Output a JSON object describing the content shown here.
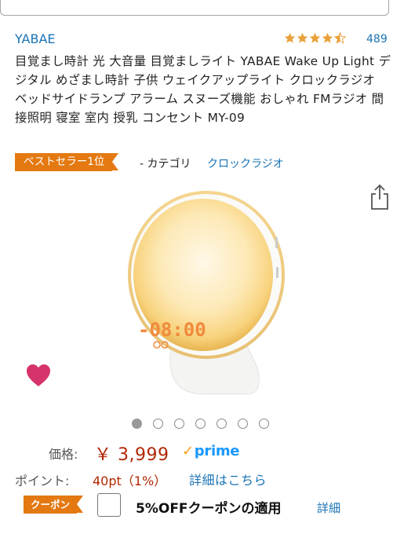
{
  "brand": "YABAE",
  "rating": {
    "stars": 4.5,
    "count": "489",
    "color": "#e9a13b"
  },
  "title": "目覚まし時計 光 大音量 目覚ましライト YABAE Wake Up Light デジタル めざまし時計 子供 ウェイクアップライト クロックラジオ ベッドサイドランプ アラーム スヌーズ機能 おしゃれ FMラジオ 間接照明 寝室 室内 授乳 コンセント MY-09",
  "bestseller": {
    "label": "ベストセラー1位",
    "prefix": "- カテゴリ",
    "category": "クロックラジオ"
  },
  "product": {
    "clock_display": "-08:00"
  },
  "carousel": {
    "count": 7,
    "active": 0
  },
  "price": {
    "label": "価格:",
    "value": "￥ 3,999",
    "prime_check": "✓",
    "prime_label": "prime"
  },
  "points": {
    "label": "ポイント:",
    "value": "40pt（1%）",
    "link": "詳細はこちら"
  },
  "coupon": {
    "badge": "クーポン",
    "text": "5%OFFクーポンの適用",
    "detail": "詳細"
  },
  "colors": {
    "link": "#1a73b5",
    "price": "#b12704",
    "badge": "#e47911",
    "heart": "#d6336c",
    "prime": "#1a98ff"
  }
}
